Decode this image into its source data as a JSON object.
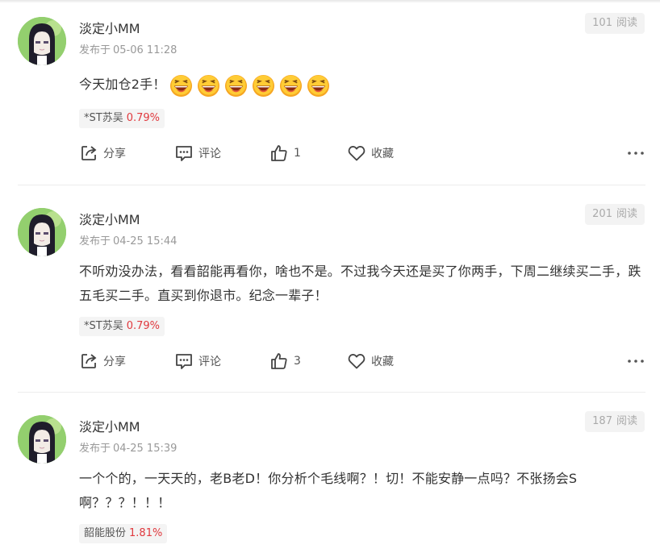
{
  "posts": [
    {
      "username": "淡定小MM",
      "posted_prefix": "发布于",
      "posted_time": "05-06 11:28",
      "reads_count": "101",
      "reads_label": "阅读",
      "content": "今天加仓2手！",
      "emoji_name": "laughing-emoji",
      "emoji_count": 6,
      "stock_name": "*ST苏吴",
      "stock_change": "0.79%",
      "share_label": "分享",
      "comment_label": "评论",
      "like_count": "1",
      "favorite_label": "收藏"
    },
    {
      "username": "淡定小MM",
      "posted_prefix": "发布于",
      "posted_time": "04-25 15:44",
      "reads_count": "201",
      "reads_label": "阅读",
      "content": "不听劝没办法，看看韶能再看你，啥也不是。不过我今天还是买了你两手，下周二继续买二手，跌五毛买二手。直买到你退市。纪念一辈子！",
      "stock_name": "*ST苏吴",
      "stock_change": "0.79%",
      "share_label": "分享",
      "comment_label": "评论",
      "like_count": "3",
      "favorite_label": "收藏"
    },
    {
      "username": "淡定小MM",
      "posted_prefix": "发布于",
      "posted_time": "04-25 15:39",
      "reads_count": "187",
      "reads_label": "阅读",
      "content": "一个个的，一天天的，老B老D！你分析个毛线啊？！切！不能安静一点吗？不张扬会S啊？？？！！！",
      "stock_name": "韶能股份",
      "stock_change": "1.81%"
    }
  ],
  "colors": {
    "stock_up": "#e0393e",
    "meta_gray": "#999999",
    "reads_bg": "#f3f3f3"
  }
}
